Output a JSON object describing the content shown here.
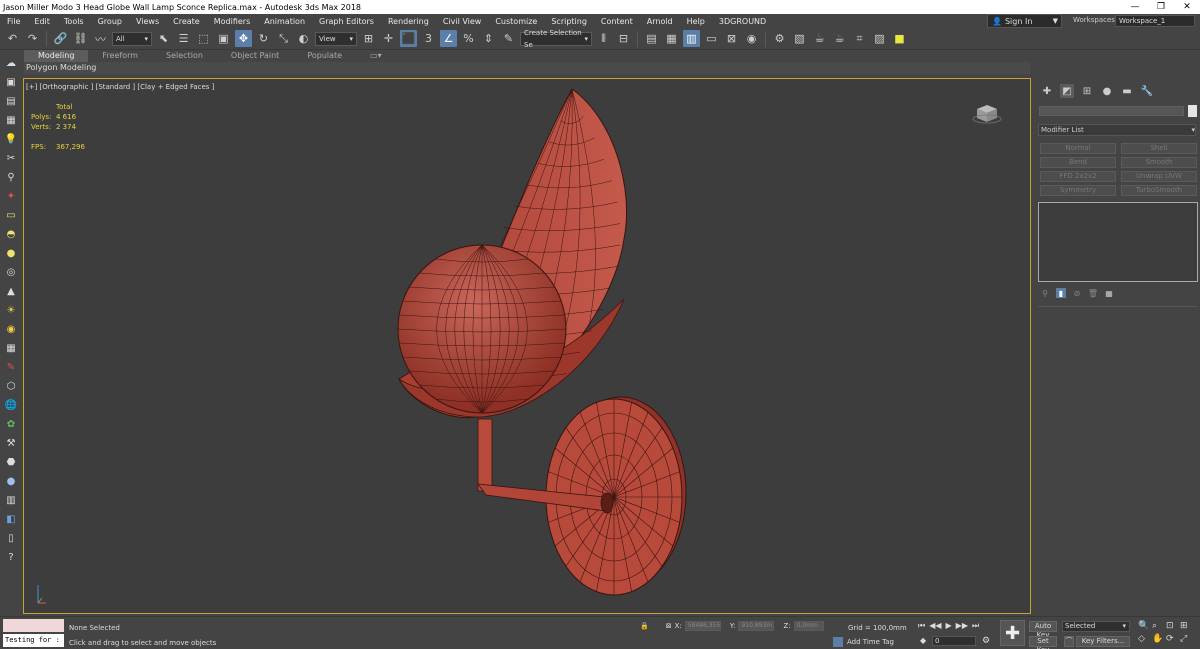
{
  "window": {
    "title": "Jason Miller Modo 3 Head Globe Wall Lamp Sconce Replica.max - Autodesk 3ds Max 2018",
    "minimize_glyph": "—",
    "maximize_glyph": "❐",
    "close_glyph": "✕"
  },
  "menu": [
    "File",
    "Edit",
    "Tools",
    "Group",
    "Views",
    "Create",
    "Modifiers",
    "Animation",
    "Graph Editors",
    "Rendering",
    "Civil View",
    "Customize",
    "Scripting",
    "Content",
    "Arnold",
    "Help",
    "3DGROUND"
  ],
  "account": {
    "sign_in": "Sign In",
    "workspaces_label": "Workspaces:",
    "workspace": "Workspace_1"
  },
  "toolbar": {
    "selection_filter": "All",
    "reference_coord": "View",
    "named_selection": "Create Selection Se"
  },
  "ribbon": {
    "tabs": [
      "Modeling",
      "Freeform",
      "Selection",
      "Object Paint",
      "Populate"
    ],
    "active_tab": "Modeling",
    "panel_label": "Polygon Modeling"
  },
  "viewport": {
    "label": "[+] [Orthographic ] [Standard ] [Clay + Edged Faces ]",
    "stats": {
      "header": "Total",
      "polys_label": "Polys:",
      "polys": "4 616",
      "verts_label": "Verts:",
      "verts": "2 374",
      "fps_label": "FPS:",
      "fps": "367,296"
    },
    "colors": {
      "model": "#b5473a",
      "wire": "#3a1410",
      "border": "#c8a23a",
      "stats": "#e8d43a"
    }
  },
  "command_panel": {
    "modifier_list": "Modifier List",
    "modifier_buttons": [
      "Normal",
      "Shell",
      "Bend",
      "Smooth",
      "FFD 2x2x2",
      "Unwrap UVW",
      "Symmetry",
      "TurboSmooth"
    ]
  },
  "status": {
    "maxscript_input": "Testing for :",
    "selection": "None Selected",
    "prompt": "Click and drag to select and move objects",
    "x_label": "X:",
    "x_value": "58486,355",
    "y_label": "Y:",
    "y_value": "910,893m",
    "z_label": "Z:",
    "z_value": "0,0mm",
    "grid": "Grid = 100,0mm",
    "add_time_tag": "Add Time Tag",
    "frame": "0",
    "auto_key": "Auto Key",
    "set_key": "Set Key",
    "key_set": "Selected",
    "key_filters": "Key Filters..."
  }
}
